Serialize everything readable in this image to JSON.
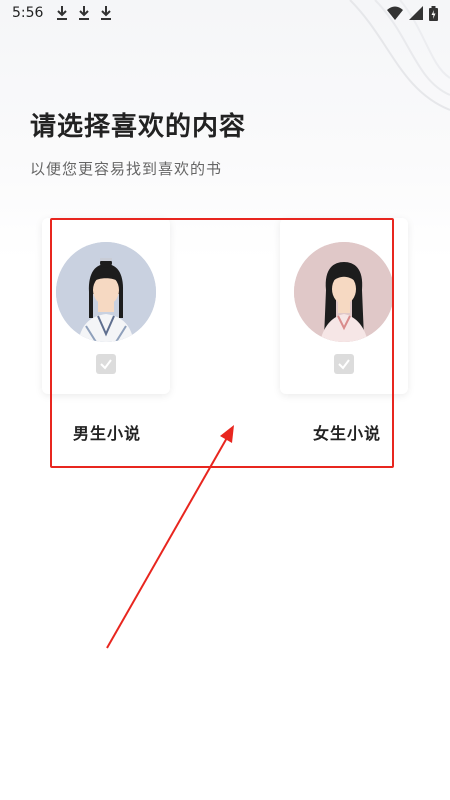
{
  "status_bar": {
    "time": "5:56",
    "download_icons": [
      "download-icon",
      "download-icon",
      "download-icon"
    ],
    "right_icons": [
      "wifi-icon",
      "signal-icon",
      "battery-icon"
    ]
  },
  "page": {
    "title": "请选择喜欢的内容",
    "subtitle": "以便您更容易找到喜欢的书"
  },
  "options": [
    {
      "label": "男生小说",
      "avatar": "male-avatar",
      "avatar_bg": "#c9d1e0",
      "selected": false
    },
    {
      "label": "女生小说",
      "avatar": "female-avatar",
      "avatar_bg": "#e0c8c8",
      "selected": false
    }
  ],
  "annotation": {
    "box_color": "#e8261f",
    "arrow_color": "#e8261f"
  }
}
